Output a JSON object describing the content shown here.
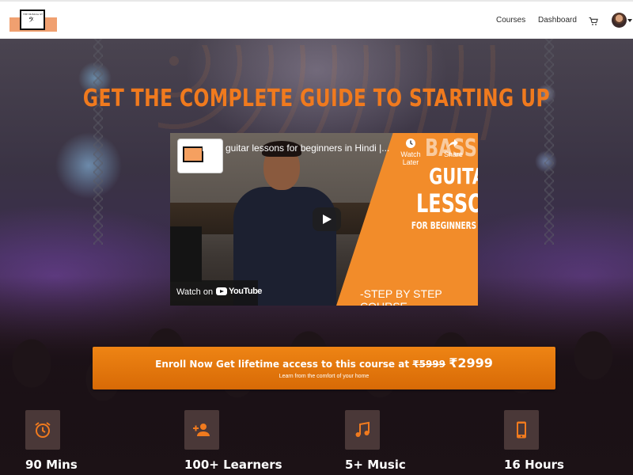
{
  "nav": {
    "logo_text": "THE MUSICAL ST",
    "logo_clef": "𝄢",
    "links": [
      "Courses",
      "Dashboard"
    ]
  },
  "hero": {
    "title": "GET THE COMPLETE GUIDE TO STARTING UP"
  },
  "video": {
    "title": "Bass guitar lessons for beginners in Hindi |...",
    "watch_later": "Watch Later",
    "share": "Share",
    "thumb_lines": [
      "BASS",
      "GUITAR",
      "LESSONS",
      "FOR BEGINNERS IN हिंदी"
    ],
    "step_text": "-STEP BY STEP COURSE-",
    "watch_on": "Watch on",
    "youtube": "YouTube"
  },
  "enroll": {
    "text": "Enroll Now Get lifetime access to this course at",
    "old_price": "₹5999",
    "new_price": "₹2999",
    "sub": "Learn from the comfort of your home"
  },
  "features": [
    {
      "icon": "alarm-clock-icon",
      "label": "90 Mins"
    },
    {
      "icon": "add-person-icon",
      "label": "100+ Learners"
    },
    {
      "icon": "music-note-icon",
      "label": "5+ Music"
    },
    {
      "icon": "smartphone-icon",
      "label": "16 Hours"
    }
  ],
  "colors": {
    "accent": "#f07a1e",
    "button": "#e47a10",
    "icon_tile": "#4a3838"
  }
}
